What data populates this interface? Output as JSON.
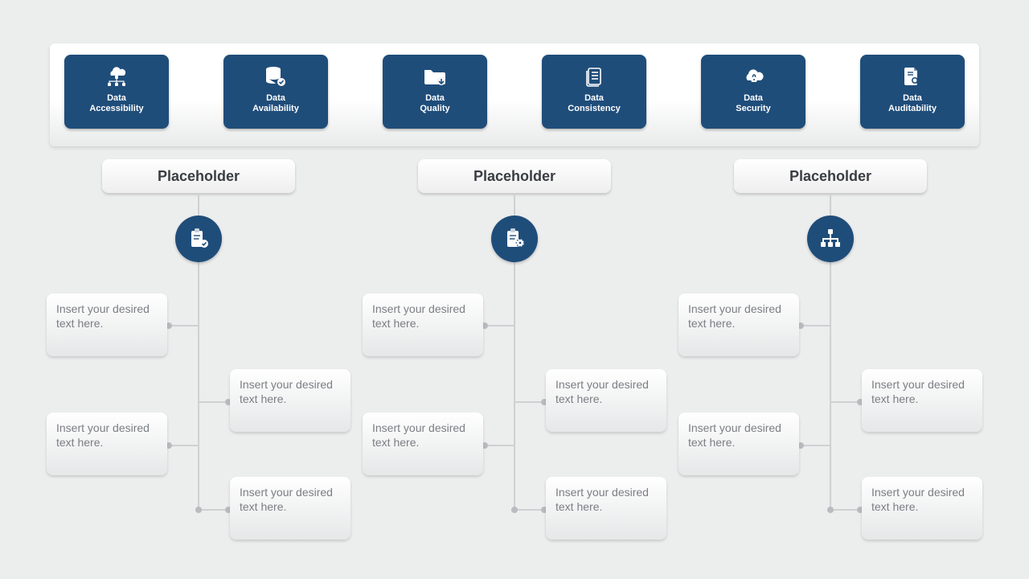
{
  "top_tiles": [
    {
      "line1": "Data",
      "line2": "Accessibility",
      "icon": "cloud-network-icon"
    },
    {
      "line1": "Data",
      "line2": "Availability",
      "icon": "database-check-icon"
    },
    {
      "line1": "Data",
      "line2": "Quality",
      "icon": "folder-arrow-icon"
    },
    {
      "line1": "Data",
      "line2": "Consistency",
      "icon": "document-lines-icon"
    },
    {
      "line1": "Data",
      "line2": "Security",
      "icon": "cloud-lock-icon"
    },
    {
      "line1": "Data",
      "line2": "Auditability",
      "icon": "document-search-icon"
    }
  ],
  "columns": [
    {
      "title": "Placeholder",
      "icon": "clipboard-check-icon",
      "l1": "Insert your desired text here.",
      "l2": "Insert your desired text here.",
      "r1": "Insert your desired text here.",
      "r2": "Insert your desired text here."
    },
    {
      "title": "Placeholder",
      "icon": "clipboard-gear-icon",
      "l1": "Insert your desired text here.",
      "l2": "Insert your desired text here.",
      "r1": "Insert your desired text here.",
      "r2": "Insert your desired text here."
    },
    {
      "title": "Placeholder",
      "icon": "org-chart-icon",
      "l1": "Insert your desired text here.",
      "l2": "Insert your desired text here.",
      "r1": "Insert your desired text here.",
      "r2": "Insert your desired text here."
    }
  ],
  "colors": {
    "accent": "#1f4d7a"
  }
}
